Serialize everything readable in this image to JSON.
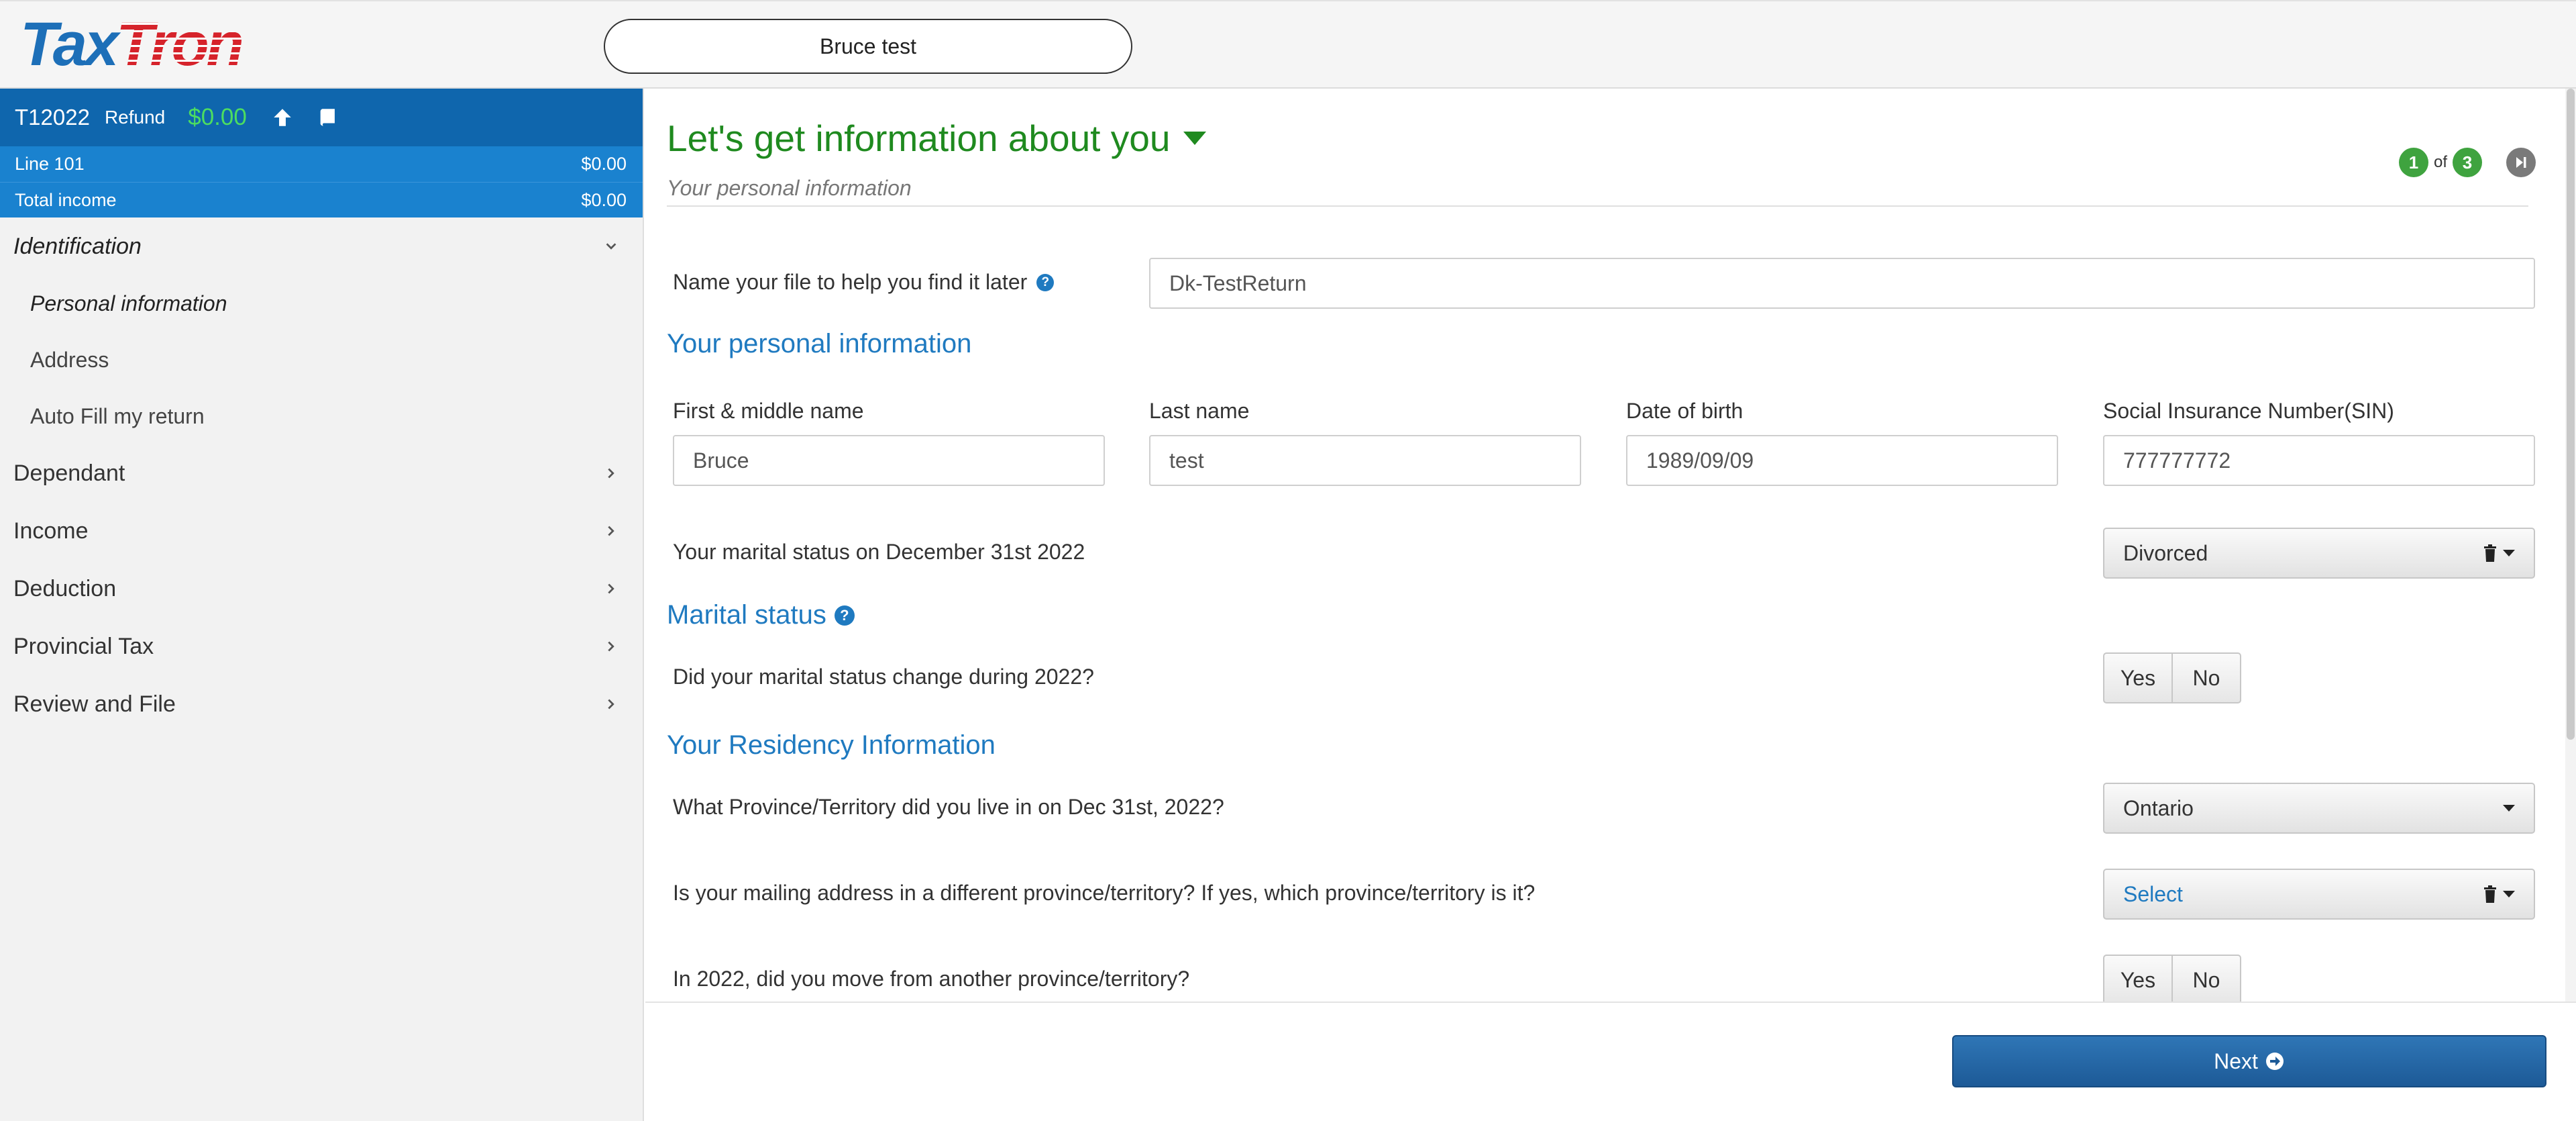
{
  "header": {
    "logo_tax": "Tax",
    "logo_tron": "Tron",
    "file_name_pill": "Bruce test"
  },
  "sidebar": {
    "summary": {
      "year": "T12022",
      "refund_label": "Refund",
      "refund_amount": "$0.00",
      "rows": [
        {
          "label": "Line 101",
          "value": "$0.00"
        },
        {
          "label": "Total income",
          "value": "$0.00"
        }
      ]
    },
    "sections": [
      {
        "label": "Identification",
        "expanded": true,
        "active": true,
        "items": [
          {
            "label": "Personal information",
            "active": true
          },
          {
            "label": "Address",
            "active": false
          },
          {
            "label": "Auto Fill my return",
            "active": false
          }
        ]
      },
      {
        "label": "Dependant",
        "expanded": false
      },
      {
        "label": "Income",
        "expanded": false
      },
      {
        "label": "Deduction",
        "expanded": false
      },
      {
        "label": "Provincial Tax",
        "expanded": false
      },
      {
        "label": "Review and File",
        "expanded": false
      }
    ]
  },
  "main": {
    "title": "Let's get information about you",
    "subtitle": "Your personal information",
    "pager": {
      "current": "1",
      "of_label": "of",
      "total": "3"
    },
    "file_name": {
      "label": "Name your file to help you find it later",
      "value": "Dk-TestReturn"
    },
    "personal_section_title": "Your personal information",
    "personal_fields": [
      {
        "label": "First & middle name",
        "value": "Bruce"
      },
      {
        "label": "Last name",
        "value": "test"
      },
      {
        "label": "Date of birth",
        "value": "1989/09/09"
      },
      {
        "label": "Social Insurance Number(SIN)",
        "value": "777777772"
      }
    ],
    "marital_question": "Your marital status on December 31st 2022",
    "marital_value": "Divorced",
    "marital_section_title": "Marital status",
    "marital_change_question": "Did your marital status change during 2022?",
    "yes_label": "Yes",
    "no_label": "No",
    "residency_section_title": "Your Residency Information",
    "province_question": "What Province/Territory did you live in on Dec 31st, 2022?",
    "province_value": "Ontario",
    "mailing_question": "Is your mailing address in a different province/territory? If yes, which province/territory is it?",
    "mailing_value": "Select",
    "moved_question": "In 2022, did you move from another province/territory?"
  },
  "footer": {
    "next_label": "Next"
  },
  "colors": {
    "brand_blue": "#0f66ad",
    "summary_blue": "#1a82cf",
    "title_green": "#1f8a1f",
    "refund_green": "#4cdd60",
    "section_blue": "#1f7ac0",
    "logo_red": "#d6232b"
  }
}
